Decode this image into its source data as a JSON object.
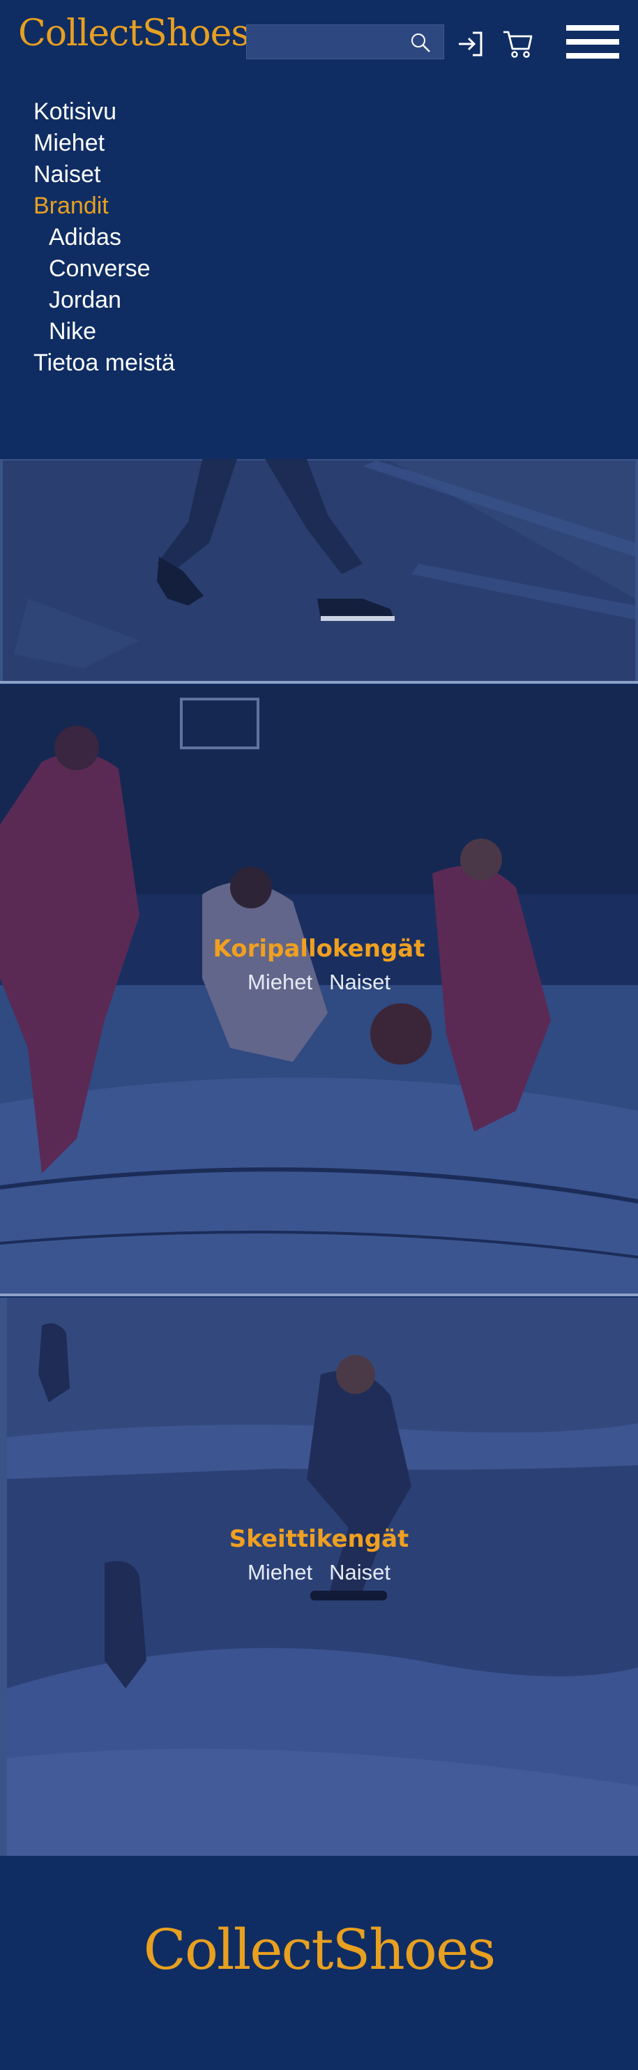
{
  "header": {
    "logo": "CollectShoes",
    "search_placeholder": "",
    "icons": [
      "search-icon",
      "login-icon",
      "cart-icon",
      "menu-icon"
    ]
  },
  "nav": {
    "items": [
      {
        "label": "Kotisivu",
        "active": false,
        "level": 0
      },
      {
        "label": "Miehet",
        "active": false,
        "level": 0
      },
      {
        "label": "Naiset",
        "active": false,
        "level": 0
      },
      {
        "label": "Brandit",
        "active": true,
        "level": 0
      },
      {
        "label": "Adidas",
        "active": false,
        "level": 1
      },
      {
        "label": "Converse",
        "active": false,
        "level": 1
      },
      {
        "label": "Jordan",
        "active": false,
        "level": 1
      },
      {
        "label": "Nike",
        "active": false,
        "level": 1
      },
      {
        "label": "Tietoa meistä",
        "active": false,
        "level": 0
      }
    ]
  },
  "banners": [
    {
      "title": "",
      "links": []
    },
    {
      "title": "Koripallokengät",
      "links": [
        "Miehet",
        "Naiset"
      ]
    },
    {
      "title": "Skeittikengät",
      "links": [
        "Miehet",
        "Naiset"
      ]
    }
  ],
  "footer": {
    "logo": "CollectShoes"
  },
  "colors": {
    "background": "#0f2d63",
    "accent": "#e8a020",
    "text": "#ffffff"
  }
}
